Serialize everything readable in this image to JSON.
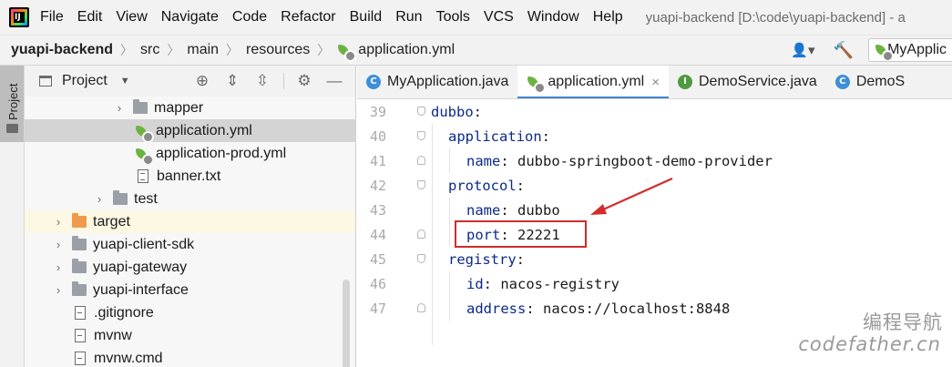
{
  "menu": {
    "items": [
      "File",
      "Edit",
      "View",
      "Navigate",
      "Code",
      "Refactor",
      "Build",
      "Run",
      "Tools",
      "VCS",
      "Window",
      "Help"
    ],
    "window_title": "yuapi-backend [D:\\code\\yuapi-backend] - a"
  },
  "breadcrumb": {
    "project": "yuapi-backend",
    "parts": [
      "src",
      "main",
      "resources"
    ],
    "file": "application.yml"
  },
  "run_config": "MyApplic",
  "stripe": {
    "label": "Project"
  },
  "project_panel": {
    "title": "Project",
    "rows": [
      {
        "label": "mapper"
      },
      {
        "label": "application.yml"
      },
      {
        "label": "application-prod.yml"
      },
      {
        "label": "banner.txt"
      },
      {
        "label": "test"
      },
      {
        "label": "target"
      },
      {
        "label": "yuapi-client-sdk"
      },
      {
        "label": "yuapi-gateway"
      },
      {
        "label": "yuapi-interface"
      },
      {
        "label": ".gitignore"
      },
      {
        "label": "mvnw"
      },
      {
        "label": "mvnw.cmd"
      }
    ]
  },
  "editor_tabs": [
    {
      "label": "MyApplication.java",
      "icon": "C"
    },
    {
      "label": "application.yml",
      "icon": "yml"
    },
    {
      "label": "DemoService.java",
      "icon": "I"
    },
    {
      "label": "DemoS",
      "icon": "C"
    }
  ],
  "editor": {
    "lines": [
      {
        "num": "39",
        "key": "dubbo",
        "sep": ":",
        "value": ""
      },
      {
        "num": "40",
        "key": "application",
        "sep": ":",
        "value": ""
      },
      {
        "num": "41",
        "key": "name",
        "sep": ": ",
        "value": "dubbo-springboot-demo-provider"
      },
      {
        "num": "42",
        "key": "protocol",
        "sep": ":",
        "value": ""
      },
      {
        "num": "43",
        "key": "name",
        "sep": ": ",
        "value": "dubbo"
      },
      {
        "num": "44",
        "key": "port",
        "sep": ": ",
        "value": "22221"
      },
      {
        "num": "45",
        "key": "registry",
        "sep": ":",
        "value": ""
      },
      {
        "num": "46",
        "key": "id",
        "sep": ": ",
        "value": "nacos-registry"
      },
      {
        "num": "47",
        "key": "address",
        "sep": ": ",
        "value": "nacos://localhost:8848"
      }
    ]
  },
  "watermark": {
    "cn": "编程导航",
    "en": "codefather.cn"
  },
  "colors": {
    "accent": "#4083c9",
    "annotation": "#d22c2c",
    "yaml_key": "#0c2a8a",
    "spring_green": "#6db33f"
  }
}
